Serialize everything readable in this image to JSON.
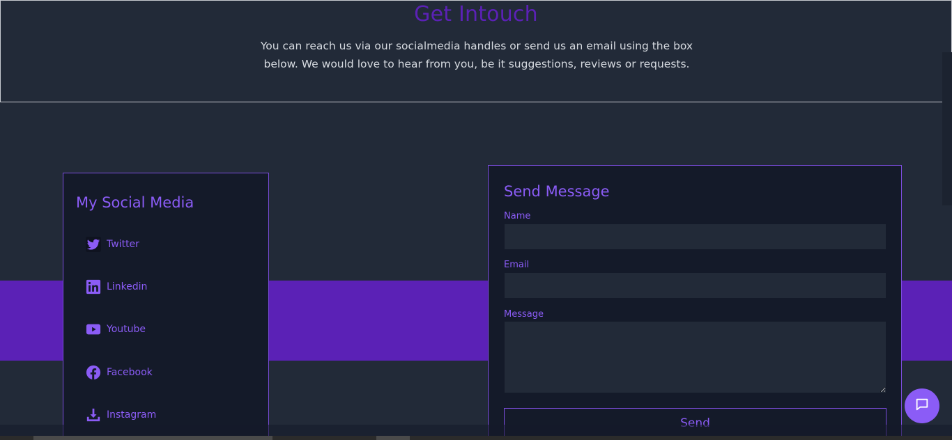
{
  "header": {
    "title": "Get Intouch",
    "description": "You can reach us via our socialmedia handles or send us an email using the box below. We would love to hear from you, be it suggestions, reviews or requests."
  },
  "social": {
    "title": "My Social Media",
    "items": [
      {
        "label": "Twitter",
        "icon": "twitter-icon"
      },
      {
        "label": "Linkedin",
        "icon": "linkedin-icon"
      },
      {
        "label": "Youtube",
        "icon": "youtube-icon"
      },
      {
        "label": "Facebook",
        "icon": "facebook-icon"
      },
      {
        "label": "Instagram",
        "icon": "download-icon"
      }
    ]
  },
  "form": {
    "title": "Send Message",
    "name_label": "Name",
    "name_value": "",
    "email_label": "Email",
    "email_value": "",
    "message_label": "Message",
    "message_value": "",
    "send_label": "Send"
  },
  "chat": {
    "icon": "chat-bubble-icon"
  },
  "colors": {
    "background": "#222a38",
    "card": "#141a29",
    "accent": "#8b5cf6",
    "band": "#5b21b6"
  }
}
